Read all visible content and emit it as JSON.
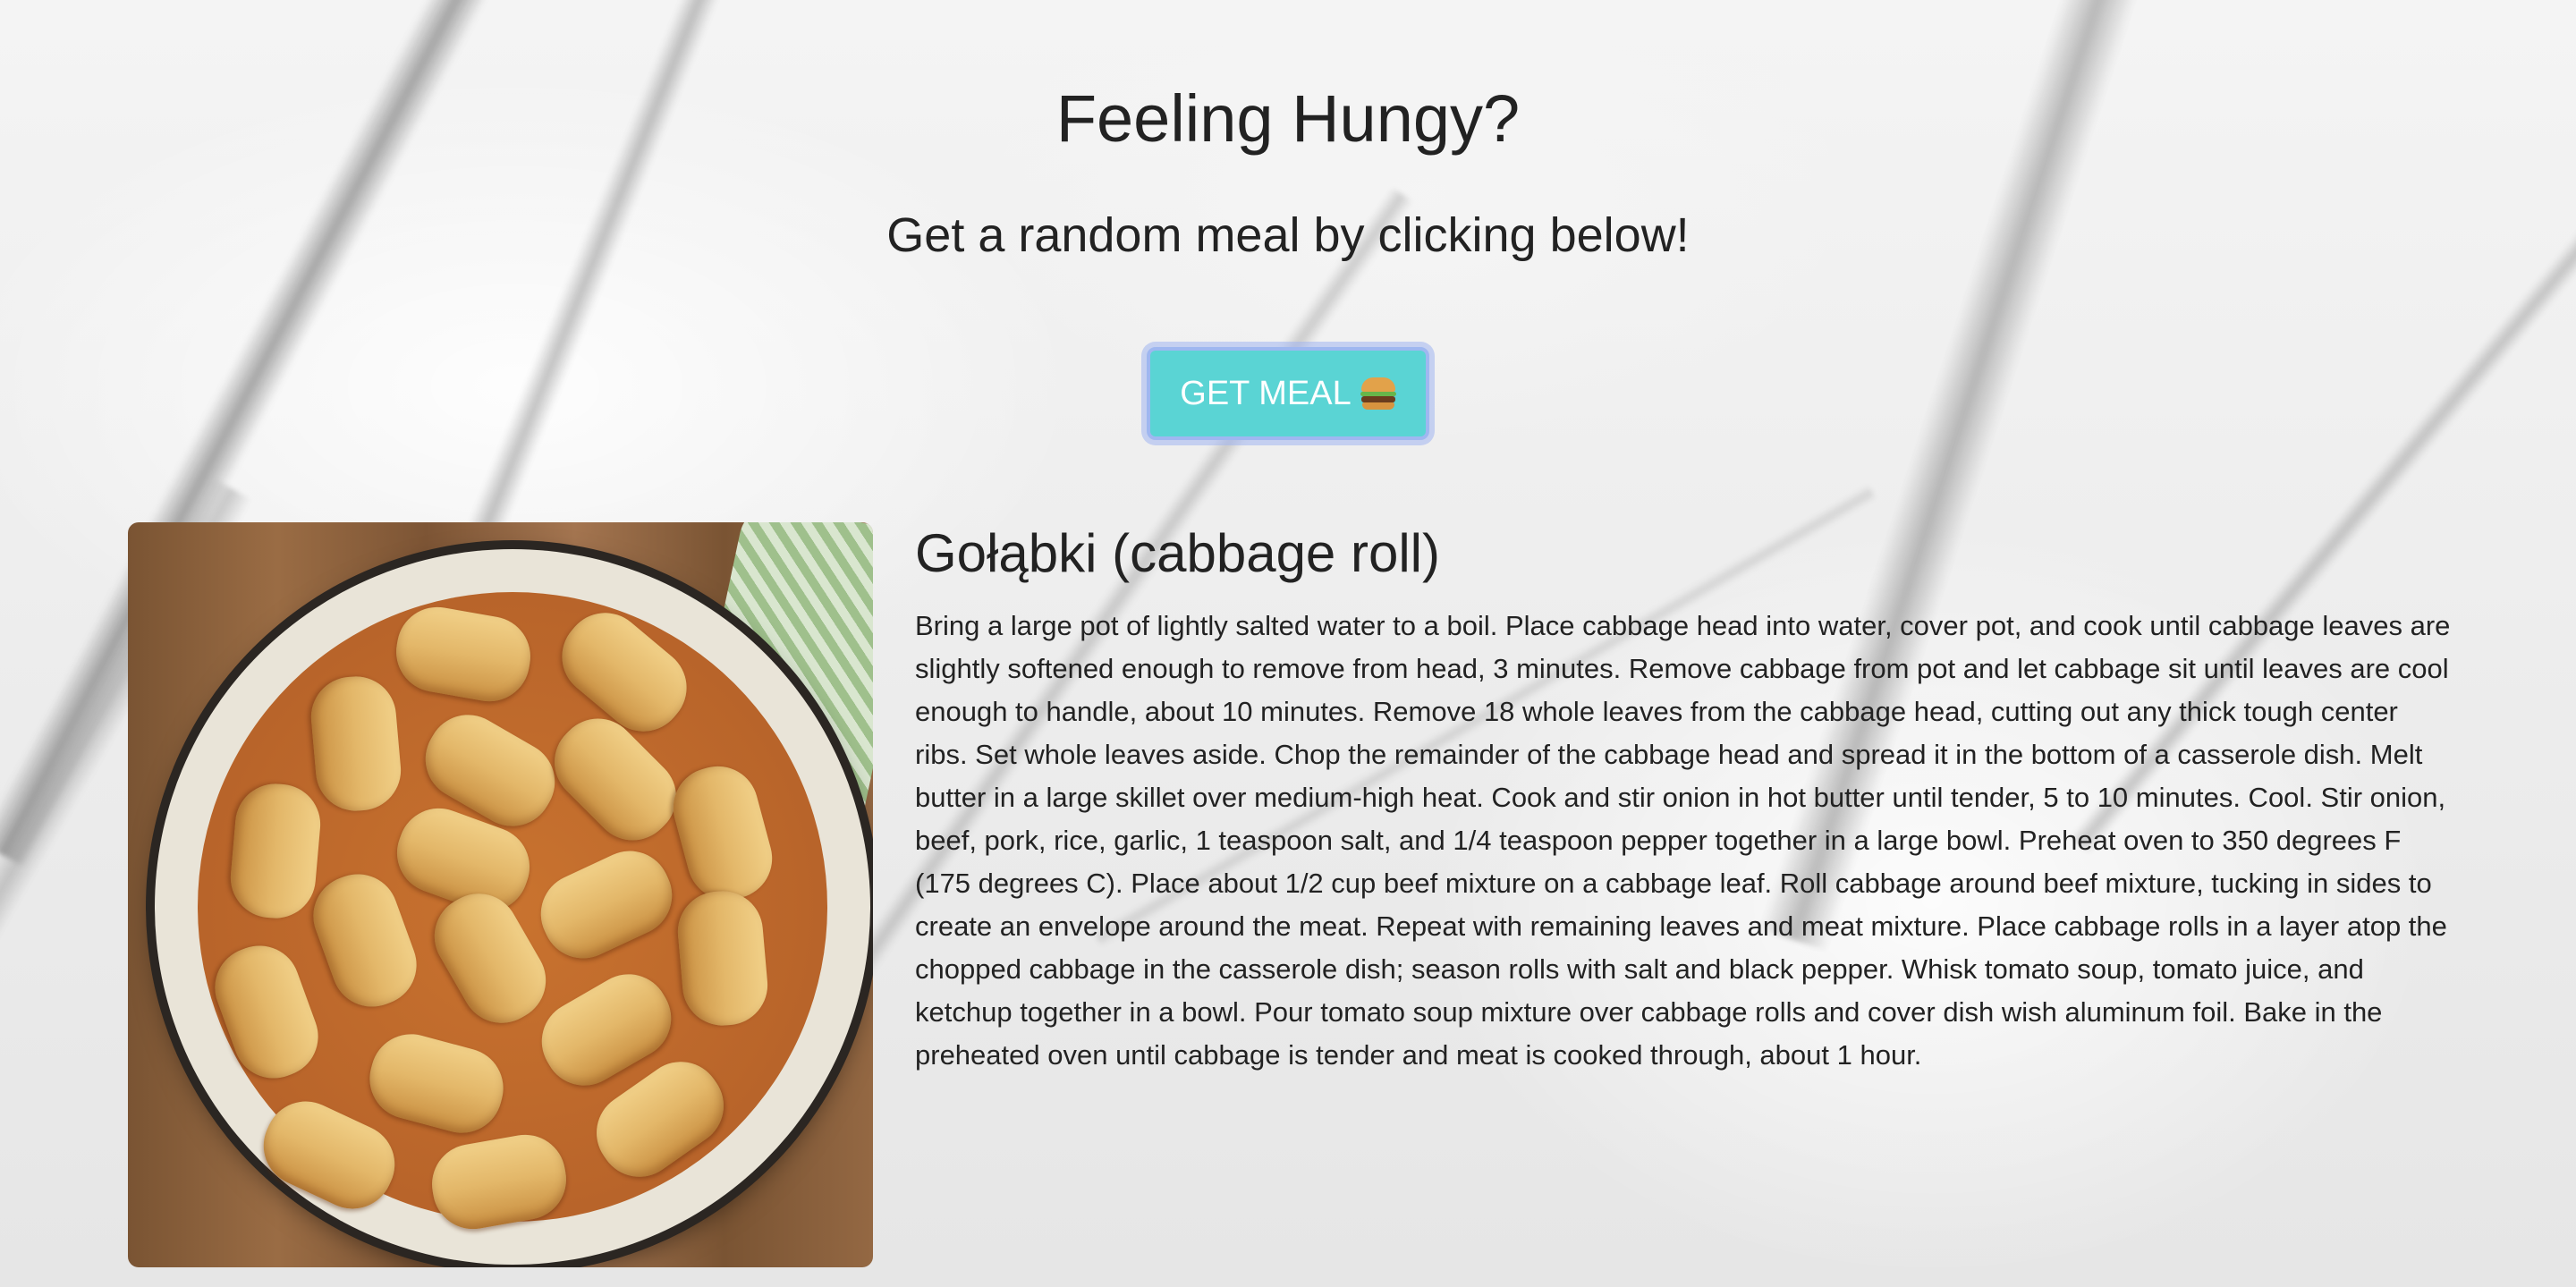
{
  "header": {
    "title": "Feeling Hungy?",
    "subtitle": "Get a random meal by clicking below!"
  },
  "button": {
    "label": "GET MEAL",
    "icon": "hamburger-icon",
    "background_color": "#5ad4d4"
  },
  "meal": {
    "name": "Gołąbki (cabbage roll)",
    "image_alt": "Gołąbki (cabbage roll)",
    "instructions": "Bring a large pot of lightly salted water to a boil. Place cabbage head into water, cover pot, and cook until cabbage leaves are slightly softened enough to remove from head, 3 minutes. Remove cabbage from pot and let cabbage sit until leaves are cool enough to handle, about 10 minutes. Remove 18 whole leaves from the cabbage head, cutting out any thick tough center ribs. Set whole leaves aside. Chop the remainder of the cabbage head and spread it in the bottom of a casserole dish. Melt butter in a large skillet over medium-high heat. Cook and stir onion in hot butter until tender, 5 to 10 minutes. Cool. Stir onion, beef, pork, rice, garlic, 1 teaspoon salt, and 1/4 teaspoon pepper together in a large bowl. Preheat oven to 350 degrees F (175 degrees C). Place about 1/2 cup beef mixture on a cabbage leaf. Roll cabbage around beef mixture, tucking in sides to create an envelope around the meat. Repeat with remaining leaves and meat mixture. Place cabbage rolls in a layer atop the chopped cabbage in the casserole dish; season rolls with salt and black pepper. Whisk tomato soup, tomato juice, and ketchup together in a bowl. Pour tomato soup mixture over cabbage rolls and cover dish wish aluminum foil. Bake in the preheated oven until cabbage is tender and meat is cooked through, about 1 hour."
  }
}
